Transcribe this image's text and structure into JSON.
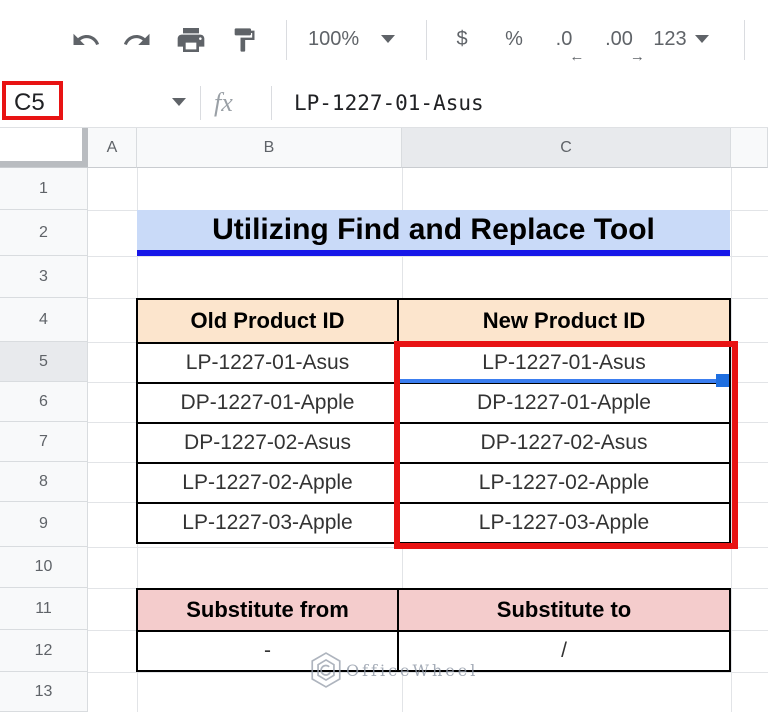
{
  "toolbar": {
    "zoom": "100%",
    "currency": "$",
    "percent": "%",
    "decrease_decimal": ".0",
    "increase_decimal": ".00",
    "more_formats": "123"
  },
  "icons": {
    "undo_icon": "undo-arrow",
    "redo_icon": "redo-arrow",
    "print_icon": "printer",
    "paint_format_icon": "paint-roller",
    "dropdown_caret": "▾",
    "decrease_decimal_arrow": "←",
    "increase_decimal_arrow": "→"
  },
  "formula_bar": {
    "name_box_value": "C5",
    "fx": "fx",
    "content": "LP-1227-01-Asus"
  },
  "grid": {
    "selected_cell": "C5",
    "column_headers": [
      "A",
      "B",
      "C"
    ],
    "row_headers": [
      "1",
      "2",
      "3",
      "4",
      "5",
      "6",
      "7",
      "8",
      "9",
      "10",
      "11",
      "12",
      "13"
    ]
  },
  "title_banner": "Utilizing Find and Replace Tool",
  "product_table": {
    "headers": [
      "Old Product ID",
      "New Product ID"
    ],
    "rows": [
      [
        "LP-1227-01-Asus",
        "LP-1227-01-Asus"
      ],
      [
        "DP-1227-01-Apple",
        "DP-1227-01-Apple"
      ],
      [
        "DP-1227-02-Asus",
        "DP-1227-02-Asus"
      ],
      [
        "LP-1227-02-Apple",
        "LP-1227-02-Apple"
      ],
      [
        "LP-1227-03-Apple",
        "LP-1227-03-Apple"
      ]
    ]
  },
  "substitute_table": {
    "headers": [
      "Substitute from",
      "Substitute to"
    ],
    "rows": [
      [
        "-",
        "/"
      ]
    ]
  },
  "watermark": "OfficeWheel",
  "colors": {
    "annotation_red": "#e81313",
    "selection_blue": "#3b7ef0",
    "fill_handle_blue": "#1f6fe0",
    "title_fill": "#c9daf8",
    "title_underline": "#1717e8",
    "product_header_fill": "#fce5cd",
    "substitute_header_fill": "#f4cccc",
    "selected_header_fill": "#e8eaed",
    "header_fill": "#f8f9fa",
    "icon_gray": "#5f6368"
  }
}
